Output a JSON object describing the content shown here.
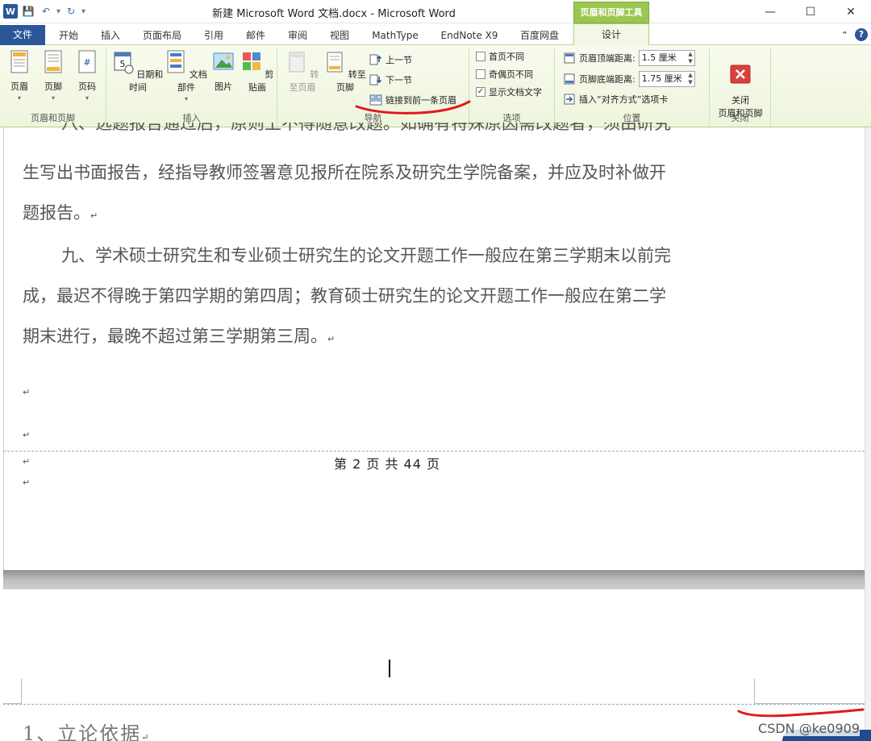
{
  "title_bar": {
    "window_title": "新建 Microsoft Word 文档.docx - Microsoft Word",
    "qat": {
      "app_logo": "W",
      "save_icon": "💾",
      "undo_icon": "↶",
      "redo_icon": "↻",
      "customize": "▾"
    },
    "buttons": {
      "minimize": "—",
      "maximize": "☐",
      "close": "✕"
    }
  },
  "context_tab_group": "页眉和页脚工具",
  "tabs": [
    {
      "label": "文件"
    },
    {
      "label": "开始"
    },
    {
      "label": "插入"
    },
    {
      "label": "页面布局"
    },
    {
      "label": "引用"
    },
    {
      "label": "邮件"
    },
    {
      "label": "审阅"
    },
    {
      "label": "视图"
    },
    {
      "label": "MathType"
    },
    {
      "label": "EndNote X9"
    },
    {
      "label": "百度网盘"
    },
    {
      "label": "设计"
    }
  ],
  "ribbon_right": {
    "collapse": "⌃",
    "help": "?"
  },
  "ribbon": {
    "groups": {
      "header_footer": {
        "label": "页眉和页脚",
        "header": "页眉",
        "footer": "页脚",
        "page_number": "页码"
      },
      "insert": {
        "label": "插入",
        "date_time": "日期和时间",
        "doc_parts": "文档部件",
        "picture": "图片",
        "clip_art": "剪贴画"
      },
      "navigation": {
        "label": "导航",
        "goto_header": "转至页眉",
        "goto_footer": "转至页脚",
        "previous_section": "上一节",
        "next_section": "下一节",
        "link_to_previous": "链接到前一条页眉"
      },
      "options": {
        "label": "选项",
        "different_first_page": "首页不同",
        "different_odd_even": "奇偶页不同",
        "show_document_text": "显示文档文字",
        "checked": [
          false,
          false,
          true
        ]
      },
      "position": {
        "label": "位置",
        "header_from_top_label": "页眉顶端距离:",
        "header_from_top_value": "1.5 厘米",
        "footer_from_bottom_label": "页脚底端距离:",
        "footer_from_bottom_value": "1.75 厘米",
        "insert_alignment_tab": "插入“对齐方式”选项卡"
      },
      "close": {
        "label": "关闭",
        "close_button": "关闭\n页眉和页脚"
      }
    }
  },
  "document": {
    "cut_top_line": "八、选题报告通过后，原则上不得随意改题。如确有特殊原因需改题者，须由研究",
    "para1_line2": "生写出书面报告，经指导教师签署意见报所在院系及研究生学院备案，并应及时补做开",
    "para1_line3": "题报告。",
    "para2_line1": "九、学术硕士研究生和专业硕士研究生的论文开题工作一般应在第三学期末以前完",
    "para2_line2": "成，最迟不得晚于第四学期的第四周；教育硕士研究生的论文开题工作一般应在第二学",
    "para2_line3": "期末进行，最晚不超过第三学期第三周。",
    "paragraph_mark": "↵",
    "footer_text": "第 2 页 共 44 页",
    "next_page_heading": "1、立论依据"
  },
  "watermark": "CSDN @ke0909"
}
